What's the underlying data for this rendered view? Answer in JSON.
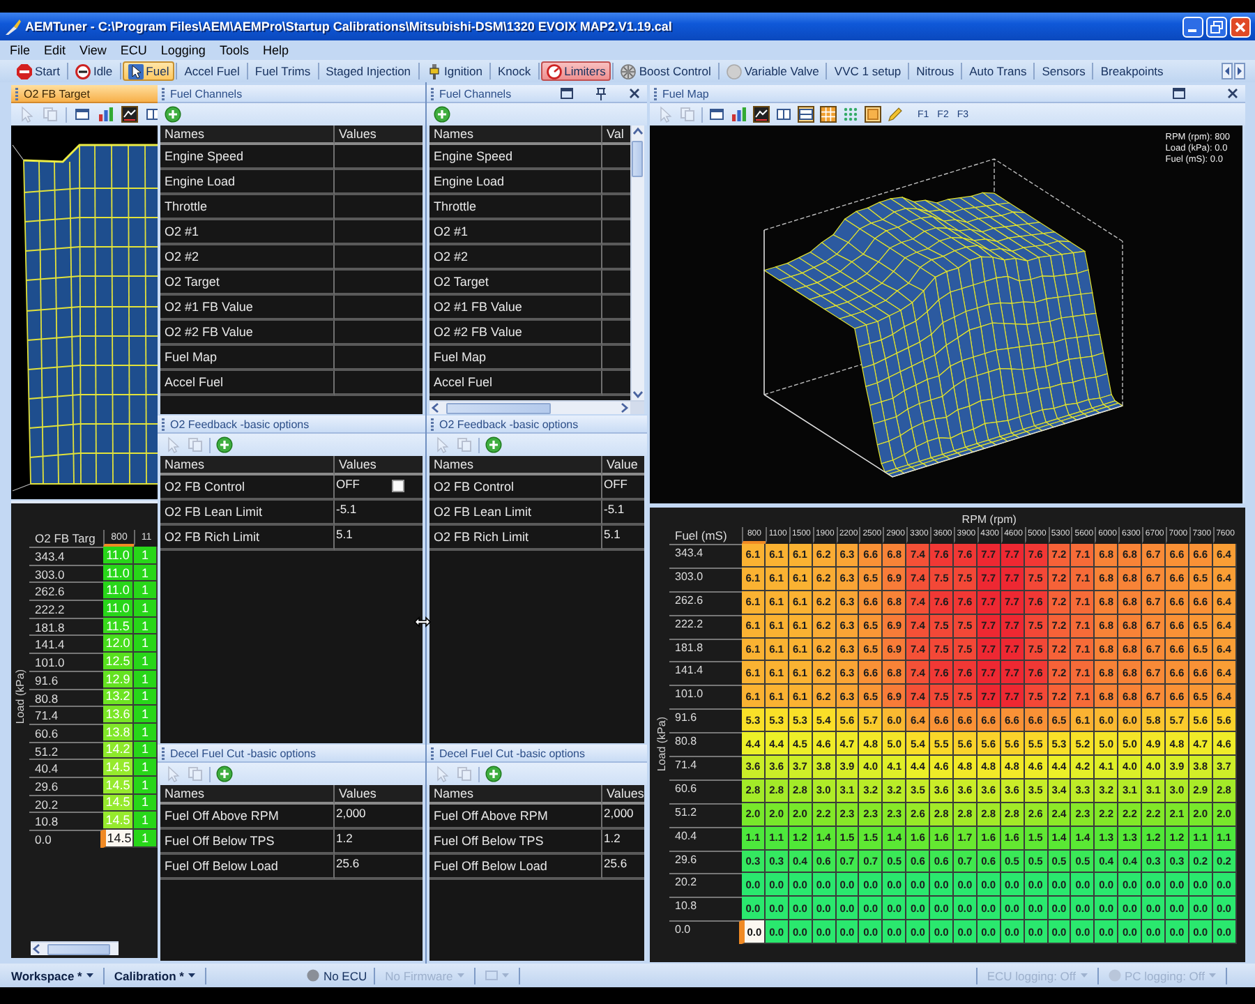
{
  "window": {
    "title": "AEMTuner - C:\\Program Files\\AEM\\AEMPro\\Startup Calibrations\\Mitsubishi-DSM\\1320 EVOIX MAP2.V1.19.cal"
  },
  "menu": [
    "File",
    "Edit",
    "View",
    "ECU",
    "Logging",
    "Tools",
    "Help"
  ],
  "modules": [
    {
      "label": "Start",
      "kind": "stop",
      "selected": false,
      "highlighted": false
    },
    {
      "label": "Idle",
      "kind": "idle",
      "selected": false,
      "highlighted": false
    },
    {
      "label": "Fuel",
      "kind": "fuel",
      "selected": true,
      "highlighted": false
    },
    {
      "label": "Accel Fuel",
      "kind": "text",
      "selected": false,
      "highlighted": false
    },
    {
      "label": "Fuel Trims",
      "kind": "text",
      "selected": false,
      "highlighted": false
    },
    {
      "label": "Staged Injection",
      "kind": "text",
      "selected": false,
      "highlighted": false
    },
    {
      "label": "Ignition",
      "kind": "ignition",
      "selected": false,
      "highlighted": false
    },
    {
      "label": "Knock",
      "kind": "text",
      "selected": false,
      "highlighted": false
    },
    {
      "label": "Limiters",
      "kind": "limiter",
      "selected": false,
      "highlighted": true
    },
    {
      "label": "Boost Control",
      "kind": "boost",
      "selected": false,
      "highlighted": false
    },
    {
      "label": "Variable Valve",
      "kind": "valve",
      "selected": false,
      "highlighted": false
    },
    {
      "label": "VVC 1 setup",
      "kind": "text",
      "selected": false,
      "highlighted": false
    },
    {
      "label": "Nitrous",
      "kind": "text",
      "selected": false,
      "highlighted": false
    },
    {
      "label": "Auto Trans",
      "kind": "text",
      "selected": false,
      "highlighted": false
    },
    {
      "label": "Sensors",
      "kind": "text",
      "selected": false,
      "highlighted": false
    },
    {
      "label": "Breakpoints",
      "kind": "text",
      "selected": false,
      "highlighted": false
    }
  ],
  "o2_fb_target": {
    "title": "O2 FB Target",
    "active": true,
    "tools": [
      {
        "kind": "cursor",
        "disabled": true,
        "pressed": false
      },
      {
        "kind": "copy",
        "disabled": true,
        "pressed": false
      },
      {
        "kind": "window",
        "disabled": false,
        "pressed": false
      },
      {
        "kind": "bars",
        "disabled": false,
        "pressed": false
      },
      {
        "kind": "surface",
        "disabled": false,
        "pressed": true
      },
      {
        "kind": "split",
        "disabled": false,
        "pressed": false
      }
    ]
  },
  "o2_fb_target_table": {
    "kind": "target",
    "corner": "O2 FB Targ",
    "y_axis": "Load (kPa)",
    "columns": [
      {
        "label": "800",
        "selected": true
      },
      {
        "label": "11",
        "selected": false
      }
    ],
    "rows": [
      {
        "label": "343.4",
        "selected": false,
        "cells": [
          "11.0",
          "1"
        ]
      },
      {
        "label": "303.0",
        "selected": false,
        "cells": [
          "11.0",
          "1"
        ]
      },
      {
        "label": "262.6",
        "selected": false,
        "cells": [
          "11.0",
          "1"
        ]
      },
      {
        "label": "222.2",
        "selected": false,
        "cells": [
          "11.0",
          "1"
        ]
      },
      {
        "label": "181.8",
        "selected": false,
        "cells": [
          "11.5",
          "1"
        ]
      },
      {
        "label": "141.4",
        "selected": false,
        "cells": [
          "12.0",
          "1"
        ]
      },
      {
        "label": "101.0",
        "selected": false,
        "cells": [
          "12.5",
          "1"
        ]
      },
      {
        "label": "91.6",
        "selected": false,
        "cells": [
          "12.9",
          "1"
        ]
      },
      {
        "label": "80.8",
        "selected": false,
        "cells": [
          "13.2",
          "1"
        ]
      },
      {
        "label": "71.4",
        "selected": false,
        "cells": [
          "13.6",
          "1"
        ]
      },
      {
        "label": "60.6",
        "selected": false,
        "cells": [
          "13.8",
          "1"
        ]
      },
      {
        "label": "51.2",
        "selected": false,
        "cells": [
          "14.2",
          "1"
        ]
      },
      {
        "label": "40.4",
        "selected": false,
        "cells": [
          "14.5",
          "1"
        ]
      },
      {
        "label": "29.6",
        "selected": false,
        "cells": [
          "14.5",
          "1"
        ]
      },
      {
        "label": "20.2",
        "selected": false,
        "cells": [
          "14.5",
          "1"
        ]
      },
      {
        "label": "10.8",
        "selected": false,
        "cells": [
          "14.5",
          "1"
        ]
      },
      {
        "label": "0.0",
        "selected": true,
        "cells": [
          "14.5",
          "1"
        ]
      }
    ]
  },
  "fuel_channels": [
    {
      "title": "Fuel Channels",
      "active": false,
      "tools": [
        {
          "kind": "add",
          "disabled": false,
          "pressed": false
        }
      ],
      "columns": [
        "Names",
        "Values"
      ],
      "rows": [
        {
          "name": "Engine Speed"
        },
        {
          "name": "Engine Load"
        },
        {
          "name": "Throttle"
        },
        {
          "name": "O2 #1"
        },
        {
          "name": "O2 #2"
        },
        {
          "name": "O2 Target"
        },
        {
          "name": "O2 #1 FB Value"
        },
        {
          "name": "O2 #2 FB Value"
        },
        {
          "name": "Fuel Map"
        },
        {
          "name": "Accel Fuel"
        }
      ]
    },
    {
      "title": "Fuel Channels",
      "active": false,
      "window_buttons": [
        {
          "kind": "maximize"
        },
        {
          "kind": "pin"
        },
        {
          "kind": "close"
        }
      ],
      "tools": [
        {
          "kind": "add",
          "disabled": false,
          "pressed": false
        }
      ],
      "columns": [
        "Names",
        "Val"
      ],
      "rows": [
        {
          "name": "Engine Speed"
        },
        {
          "name": "Engine Load"
        },
        {
          "name": "Throttle"
        },
        {
          "name": "O2 #1"
        },
        {
          "name": "O2 #2"
        },
        {
          "name": "O2 Target"
        },
        {
          "name": "O2 #1 FB Value"
        },
        {
          "name": "O2 #2 FB Value"
        },
        {
          "name": "Fuel Map"
        },
        {
          "name": "Accel Fuel"
        }
      ]
    }
  ],
  "o2_feedback": [
    {
      "title": "O2 Feedback -basic options",
      "active": false,
      "tools": [
        {
          "kind": "cursor",
          "disabled": true,
          "pressed": false
        },
        {
          "kind": "copy",
          "disabled": true,
          "pressed": false
        },
        {
          "kind": "add",
          "disabled": false,
          "pressed": false
        }
      ],
      "columns": [
        "Names",
        "Values"
      ],
      "rows": [
        {
          "name": "O2 FB Control",
          "value": "OFF",
          "checked": false
        },
        {
          "name": "O2 FB Lean Limit",
          "value": "-5.1"
        },
        {
          "name": "O2 FB Rich Limit",
          "value": "5.1"
        }
      ]
    },
    {
      "title": "O2 Feedback -basic options",
      "active": false,
      "tools": [
        {
          "kind": "cursor",
          "disabled": true,
          "pressed": false
        },
        {
          "kind": "copy",
          "disabled": true,
          "pressed": false
        },
        {
          "kind": "add",
          "disabled": false,
          "pressed": false
        }
      ],
      "columns": [
        "Names",
        "Value"
      ],
      "rows": [
        {
          "name": "O2 FB Control",
          "value": "OFF"
        },
        {
          "name": "O2 FB Lean Limit",
          "value": "-5.1"
        },
        {
          "name": "O2 FB Rich Limit",
          "value": "5.1"
        }
      ]
    }
  ],
  "decel_fuel_cut": [
    {
      "title": "Decel Fuel Cut -basic options",
      "active": false,
      "tools": [
        {
          "kind": "cursor",
          "disabled": true,
          "pressed": false
        },
        {
          "kind": "copy",
          "disabled": true,
          "pressed": false
        },
        {
          "kind": "add",
          "disabled": false,
          "pressed": false
        }
      ],
      "columns": [
        "Names",
        "Values"
      ],
      "rows": [
        {
          "name": "Fuel Off Above RPM",
          "value": "2,000"
        },
        {
          "name": "Fuel Off Below TPS",
          "value": "1.2"
        },
        {
          "name": "Fuel Off Below Load",
          "value": "25.6"
        }
      ]
    },
    {
      "title": "Decel Fuel Cut -basic options",
      "active": false,
      "tools": [
        {
          "kind": "cursor",
          "disabled": true,
          "pressed": false
        },
        {
          "kind": "copy",
          "disabled": true,
          "pressed": false
        },
        {
          "kind": "add",
          "disabled": false,
          "pressed": false
        }
      ],
      "columns": [
        "Names",
        "Values"
      ],
      "rows": [
        {
          "name": "Fuel Off Above RPM",
          "value": "2,000"
        },
        {
          "name": "Fuel Off Below TPS",
          "value": "1.2"
        },
        {
          "name": "Fuel Off Below Load",
          "value": "25.6"
        }
      ]
    }
  ],
  "fuel_map": {
    "title": "Fuel Map",
    "active": false,
    "window_buttons": [
      {
        "kind": "maximize"
      },
      {
        "kind": "close"
      }
    ],
    "tools": [
      {
        "kind": "cursor",
        "disabled": true,
        "pressed": false
      },
      {
        "kind": "copy",
        "disabled": true,
        "pressed": false
      },
      {
        "kind": "window",
        "disabled": false,
        "pressed": false
      },
      {
        "kind": "bars",
        "disabled": false,
        "pressed": false
      },
      {
        "kind": "surface",
        "disabled": false,
        "pressed": true
      },
      {
        "kind": "split",
        "disabled": false,
        "pressed": false
      },
      {
        "kind": "rows",
        "disabled": false,
        "pressed": true
      },
      {
        "kind": "grid",
        "disabled": false,
        "pressed": true
      },
      {
        "kind": "dots",
        "disabled": false,
        "pressed": false
      },
      {
        "kind": "tile",
        "disabled": false,
        "pressed": true
      },
      {
        "kind": "pencil",
        "disabled": false,
        "pressed": false
      }
    ],
    "presets": [
      "F1",
      "F2",
      "F3"
    ],
    "readout": [
      "RPM (rpm): 800",
      "Load (kPa): 0.0",
      "Fuel (mS): 0.0"
    ]
  },
  "fuel_map_table": {
    "kind": "fuel",
    "title": "RPM (rpm)",
    "corner": "Fuel (mS)",
    "y_axis": "Load (kPa)",
    "columns": [
      {
        "label": "800",
        "selected": true
      },
      {
        "label": "1100",
        "selected": false
      },
      {
        "label": "1500",
        "selected": false
      },
      {
        "label": "1900",
        "selected": false
      },
      {
        "label": "2200",
        "selected": false
      },
      {
        "label": "2500",
        "selected": false
      },
      {
        "label": "2900",
        "selected": false
      },
      {
        "label": "3300",
        "selected": false
      },
      {
        "label": "3600",
        "selected": false
      },
      {
        "label": "3900",
        "selected": false
      },
      {
        "label": "4300",
        "selected": false
      },
      {
        "label": "4600",
        "selected": false
      },
      {
        "label": "5000",
        "selected": false
      },
      {
        "label": "5300",
        "selected": false
      },
      {
        "label": "5600",
        "selected": false
      },
      {
        "label": "6000",
        "selected": false
      },
      {
        "label": "6300",
        "selected": false
      },
      {
        "label": "6700",
        "selected": false
      },
      {
        "label": "7000",
        "selected": false
      },
      {
        "label": "7300",
        "selected": false
      },
      {
        "label": "7600",
        "selected": false
      }
    ],
    "rows": [
      {
        "label": "343.4",
        "selected": false,
        "cells": [
          "6.1",
          "6.1",
          "6.1",
          "6.2",
          "6.3",
          "6.6",
          "6.8",
          "7.4",
          "7.6",
          "7.6",
          "7.7",
          "7.7",
          "7.6",
          "7.2",
          "7.1",
          "6.8",
          "6.8",
          "6.7",
          "6.6",
          "6.6",
          "6.4"
        ]
      },
      {
        "label": "303.0",
        "selected": false,
        "cells": [
          "6.1",
          "6.1",
          "6.1",
          "6.2",
          "6.3",
          "6.5",
          "6.9",
          "7.4",
          "7.5",
          "7.5",
          "7.7",
          "7.7",
          "7.5",
          "7.2",
          "7.1",
          "6.8",
          "6.8",
          "6.7",
          "6.6",
          "6.5",
          "6.4"
        ]
      },
      {
        "label": "262.6",
        "selected": false,
        "cells": [
          "6.1",
          "6.1",
          "6.1",
          "6.2",
          "6.3",
          "6.6",
          "6.8",
          "7.4",
          "7.6",
          "7.6",
          "7.7",
          "7.7",
          "7.6",
          "7.2",
          "7.1",
          "6.8",
          "6.8",
          "6.7",
          "6.6",
          "6.6",
          "6.4"
        ]
      },
      {
        "label": "222.2",
        "selected": false,
        "cells": [
          "6.1",
          "6.1",
          "6.1",
          "6.2",
          "6.3",
          "6.5",
          "6.9",
          "7.4",
          "7.5",
          "7.5",
          "7.7",
          "7.7",
          "7.5",
          "7.2",
          "7.1",
          "6.8",
          "6.8",
          "6.7",
          "6.6",
          "6.5",
          "6.4"
        ]
      },
      {
        "label": "181.8",
        "selected": false,
        "cells": [
          "6.1",
          "6.1",
          "6.1",
          "6.2",
          "6.3",
          "6.5",
          "6.9",
          "7.4",
          "7.5",
          "7.5",
          "7.7",
          "7.7",
          "7.5",
          "7.2",
          "7.1",
          "6.8",
          "6.8",
          "6.7",
          "6.6",
          "6.5",
          "6.4"
        ]
      },
      {
        "label": "141.4",
        "selected": false,
        "cells": [
          "6.1",
          "6.1",
          "6.1",
          "6.2",
          "6.3",
          "6.6",
          "6.8",
          "7.4",
          "7.6",
          "7.6",
          "7.7",
          "7.7",
          "7.6",
          "7.2",
          "7.1",
          "6.8",
          "6.8",
          "6.7",
          "6.6",
          "6.6",
          "6.4"
        ]
      },
      {
        "label": "101.0",
        "selected": false,
        "cells": [
          "6.1",
          "6.1",
          "6.1",
          "6.2",
          "6.3",
          "6.5",
          "6.9",
          "7.4",
          "7.5",
          "7.5",
          "7.7",
          "7.7",
          "7.5",
          "7.2",
          "7.1",
          "6.8",
          "6.8",
          "6.7",
          "6.6",
          "6.5",
          "6.4"
        ]
      },
      {
        "label": "91.6",
        "selected": false,
        "cells": [
          "5.3",
          "5.3",
          "5.3",
          "5.4",
          "5.6",
          "5.7",
          "6.0",
          "6.4",
          "6.6",
          "6.6",
          "6.6",
          "6.6",
          "6.6",
          "6.5",
          "6.1",
          "6.0",
          "6.0",
          "5.8",
          "5.7",
          "5.6",
          "5.6"
        ]
      },
      {
        "label": "80.8",
        "selected": false,
        "cells": [
          "4.4",
          "4.4",
          "4.5",
          "4.6",
          "4.7",
          "4.8",
          "5.0",
          "5.4",
          "5.5",
          "5.6",
          "5.6",
          "5.6",
          "5.5",
          "5.3",
          "5.2",
          "5.0",
          "5.0",
          "4.9",
          "4.8",
          "4.7",
          "4.6"
        ]
      },
      {
        "label": "71.4",
        "selected": false,
        "cells": [
          "3.6",
          "3.6",
          "3.7",
          "3.8",
          "3.9",
          "4.0",
          "4.1",
          "4.4",
          "4.6",
          "4.8",
          "4.8",
          "4.8",
          "4.6",
          "4.4",
          "4.2",
          "4.1",
          "4.0",
          "4.0",
          "3.9",
          "3.8",
          "3.7"
        ]
      },
      {
        "label": "60.6",
        "selected": false,
        "cells": [
          "2.8",
          "2.8",
          "2.8",
          "3.0",
          "3.1",
          "3.2",
          "3.2",
          "3.5",
          "3.6",
          "3.6",
          "3.6",
          "3.6",
          "3.5",
          "3.4",
          "3.3",
          "3.2",
          "3.1",
          "3.1",
          "3.0",
          "2.9",
          "2.8"
        ]
      },
      {
        "label": "51.2",
        "selected": false,
        "cells": [
          "2.0",
          "2.0",
          "2.0",
          "2.2",
          "2.3",
          "2.3",
          "2.3",
          "2.6",
          "2.8",
          "2.8",
          "2.8",
          "2.8",
          "2.6",
          "2.4",
          "2.3",
          "2.2",
          "2.2",
          "2.2",
          "2.1",
          "2.0",
          "2.0"
        ]
      },
      {
        "label": "40.4",
        "selected": false,
        "cells": [
          "1.1",
          "1.1",
          "1.2",
          "1.4",
          "1.5",
          "1.5",
          "1.4",
          "1.6",
          "1.6",
          "1.7",
          "1.6",
          "1.6",
          "1.5",
          "1.4",
          "1.4",
          "1.3",
          "1.3",
          "1.2",
          "1.2",
          "1.1",
          "1.1"
        ]
      },
      {
        "label": "29.6",
        "selected": false,
        "cells": [
          "0.3",
          "0.3",
          "0.4",
          "0.6",
          "0.7",
          "0.7",
          "0.5",
          "0.6",
          "0.6",
          "0.7",
          "0.6",
          "0.5",
          "0.5",
          "0.5",
          "0.5",
          "0.4",
          "0.4",
          "0.3",
          "0.3",
          "0.2",
          "0.2"
        ]
      },
      {
        "label": "20.2",
        "selected": false,
        "cells": [
          "0.0",
          "0.0",
          "0.0",
          "0.0",
          "0.0",
          "0.0",
          "0.0",
          "0.0",
          "0.0",
          "0.0",
          "0.0",
          "0.0",
          "0.0",
          "0.0",
          "0.0",
          "0.0",
          "0.0",
          "0.0",
          "0.0",
          "0.0",
          "0.0"
        ]
      },
      {
        "label": "10.8",
        "selected": false,
        "cells": [
          "0.0",
          "0.0",
          "0.0",
          "0.0",
          "0.0",
          "0.0",
          "0.0",
          "0.0",
          "0.0",
          "0.0",
          "0.0",
          "0.0",
          "0.0",
          "0.0",
          "0.0",
          "0.0",
          "0.0",
          "0.0",
          "0.0",
          "0.0",
          "0.0"
        ]
      },
      {
        "label": "0.0",
        "selected": true,
        "cells": [
          "0.0",
          "0.0",
          "0.0",
          "0.0",
          "0.0",
          "0.0",
          "0.0",
          "0.0",
          "0.0",
          "0.0",
          "0.0",
          "0.0",
          "0.0",
          "0.0",
          "0.0",
          "0.0",
          "0.0",
          "0.0",
          "0.0",
          "0.0",
          "0.0"
        ]
      }
    ]
  },
  "status_bar": {
    "left": [
      {
        "kind": "dropdown",
        "label": "Workspace *",
        "disabled": false
      },
      {
        "kind": "dropdown",
        "label": "Calibration *",
        "disabled": false
      }
    ],
    "center": [
      {
        "kind": "status",
        "label": "No ECU",
        "disabled": false
      },
      {
        "kind": "dropdown",
        "label": "No Firmware",
        "disabled": true
      },
      {
        "kind": "icon-dropdown",
        "disabled": true
      }
    ],
    "right": [
      {
        "kind": "dropdown",
        "label": "ECU logging: Off",
        "disabled": true
      },
      {
        "kind": "status-dropdown",
        "label": "PC logging: Off",
        "disabled": true
      }
    ]
  }
}
